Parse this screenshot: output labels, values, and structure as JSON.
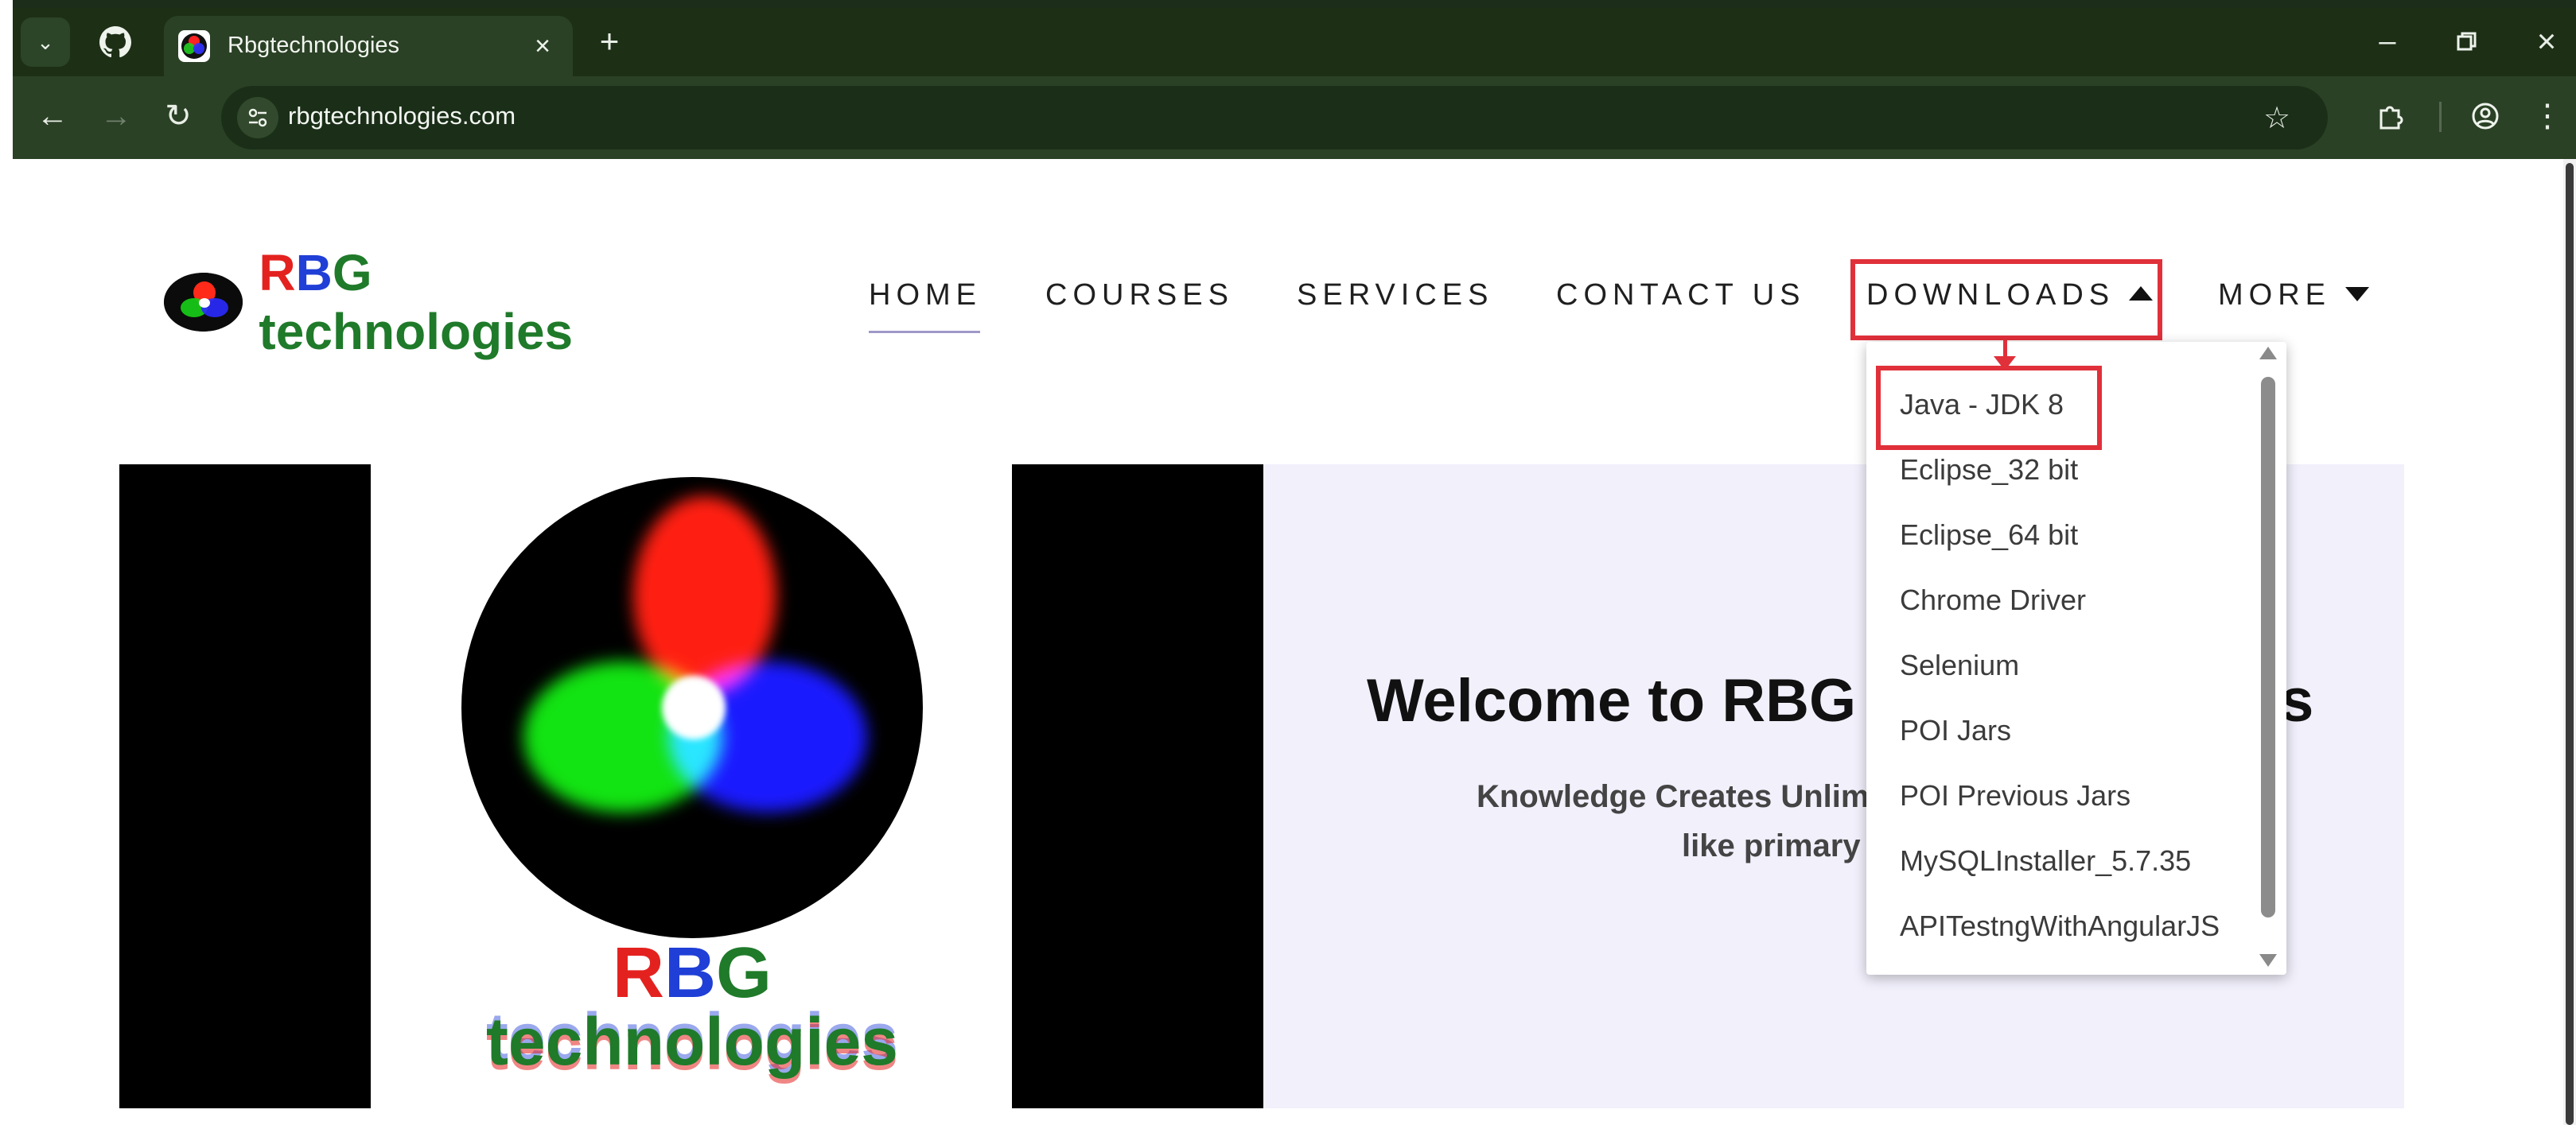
{
  "browser": {
    "tab_title": "Rbgtechnologies",
    "url": "rbgtechnologies.com"
  },
  "site": {
    "logo_parts": [
      "RBG",
      "technologies"
    ],
    "nav": [
      {
        "label": "HOME"
      },
      {
        "label": "COURSES"
      },
      {
        "label": "SERVICES"
      },
      {
        "label": "CONTACT US"
      },
      {
        "label": "DOWNLOADS"
      },
      {
        "label": "MORE"
      }
    ],
    "downloads_menu": [
      "Java - JDK 8",
      "Eclipse_32 bit",
      "Eclipse_64 bit",
      "Chrome Driver",
      "Selenium",
      "POI Jars",
      "POI Previous Jars",
      "MySQLInstaller_5.7.35",
      "APITestngWithAngularJS"
    ],
    "hero": {
      "banner_rbg": "RBG",
      "banner_tech": "technologies",
      "welcome": "Welcome to RBG",
      "welcome_tail": "s",
      "tagline_line1": "Knowledge Creates Unlim",
      "tagline_line2": "like primary"
    }
  },
  "colors": {
    "red": "#e3221f",
    "blue": "#1f3fd6",
    "green": "#1f7a2a",
    "highlight": "#e0303a"
  }
}
